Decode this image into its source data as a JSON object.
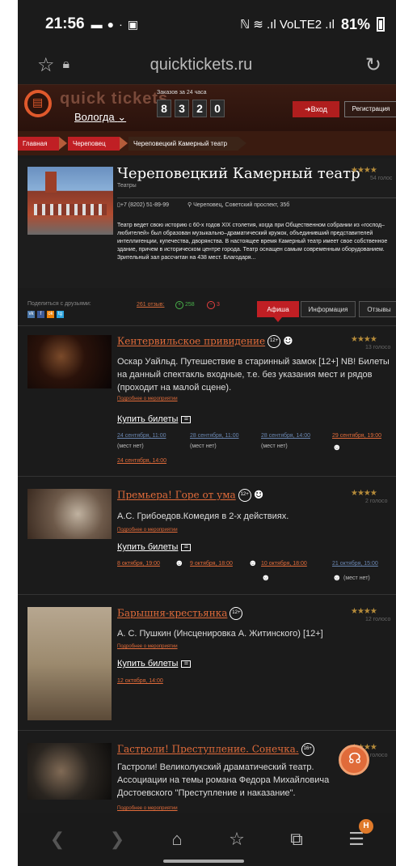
{
  "status": {
    "time": "21:56",
    "signal": "ℕ ≋ .ıl VoLTE2 .ıl",
    "battery": "81%"
  },
  "browser": {
    "url": "quicktickets.ru"
  },
  "site": {
    "logo_text": "quick tickets",
    "city": "Вологда",
    "orders_label": "Заказов за 24 часа",
    "digits": [
      "8",
      "3",
      "2",
      "0"
    ],
    "login": "Вход",
    "register": "Регистрация"
  },
  "breadcrumbs": [
    "Главная",
    "Череповец",
    "Череповецкий Камерный театр"
  ],
  "theatre": {
    "title": "Череповецкий Камерный театр",
    "category": "Театры",
    "stars": "★★★★",
    "reviews": "54 голос",
    "phone": "+7 (8202) 51-89-99",
    "address": "Череповец, Советский проспект, 35б",
    "description": "Театр ведет свою историю с 60-х годов XIX столетия, когда при Общественном собрании из «господ–любителей» был образован музыкально–драматический кружок, объединивший представителей интеллигенции, купечества, дворянства. В настоящее время Камерный театр имеет свое собственное здание, причем в историческом центре города. Театр оснащен самым современным оборудованием. Зрительный зал рассчитан на 438 мест. Благодаря..."
  },
  "share": {
    "label": "Поделиться с друзьями:",
    "socials": [
      "vk",
      "f",
      "ok",
      "tg"
    ],
    "reviews_link": "261 отзыв:",
    "positive": "258",
    "negative": "3"
  },
  "tabs": [
    "Афиша",
    "Информация",
    "Отзывы"
  ],
  "events": [
    {
      "title": "Кентервильское привидение",
      "age": "12+",
      "stars": "★★★★",
      "reviews": "13 голосо",
      "desc": "Оскар Уайльд. Путешествие в старинный замок [12+] NB! Билеты на данный спектакль входные, т.е. без указания мест и рядов (проходит на малой сцене).",
      "more": "Подробнее о мероприятии",
      "buy": "Купить билеты",
      "sessions": [
        "24 сентября, 11:00",
        "28 сентября, 11:00",
        "28 сентября, 14:00",
        "29 сентября, 19:00",
        "24 сентября, 14:00"
      ],
      "no_seats": "(мест нет)"
    },
    {
      "title": "Премьера! Горе от ума",
      "age": "12+",
      "stars": "★★★★",
      "reviews": "2 голосо",
      "desc": "А.С. Грибоедов.Комедия в 2-х действиях.",
      "more": "Подробнее о мероприятии",
      "buy": "Купить билеты",
      "sessions": [
        "8 октября, 19:00",
        "9 октября, 18:00",
        "10 октября, 18:00",
        "21 октября, 15:00"
      ],
      "no_seats": "(мест нет)"
    },
    {
      "title": "Барышня-крестьянка",
      "age": "12+",
      "stars": "★★★★",
      "reviews": "12 голосо",
      "desc": "А. С. Пушкин (Инсценировка А. Житинского) [12+]",
      "more": "Подробнее о мероприятии",
      "buy": "Купить билеты",
      "sessions": [
        "12 октября, 14:00"
      ]
    },
    {
      "title": "Гастроли! Преступление. Сонечка.",
      "age": "16+",
      "stars": "★★★★",
      "reviews": "0 голосо",
      "desc": "Гастроли! Великолукский драматический театр. Ассоциации на темы романа Федора Михайловича Достоевского \"Преступление и наказание\".",
      "more": "Подробнее о мероприятии"
    }
  ],
  "nav": {
    "badge": "H"
  }
}
